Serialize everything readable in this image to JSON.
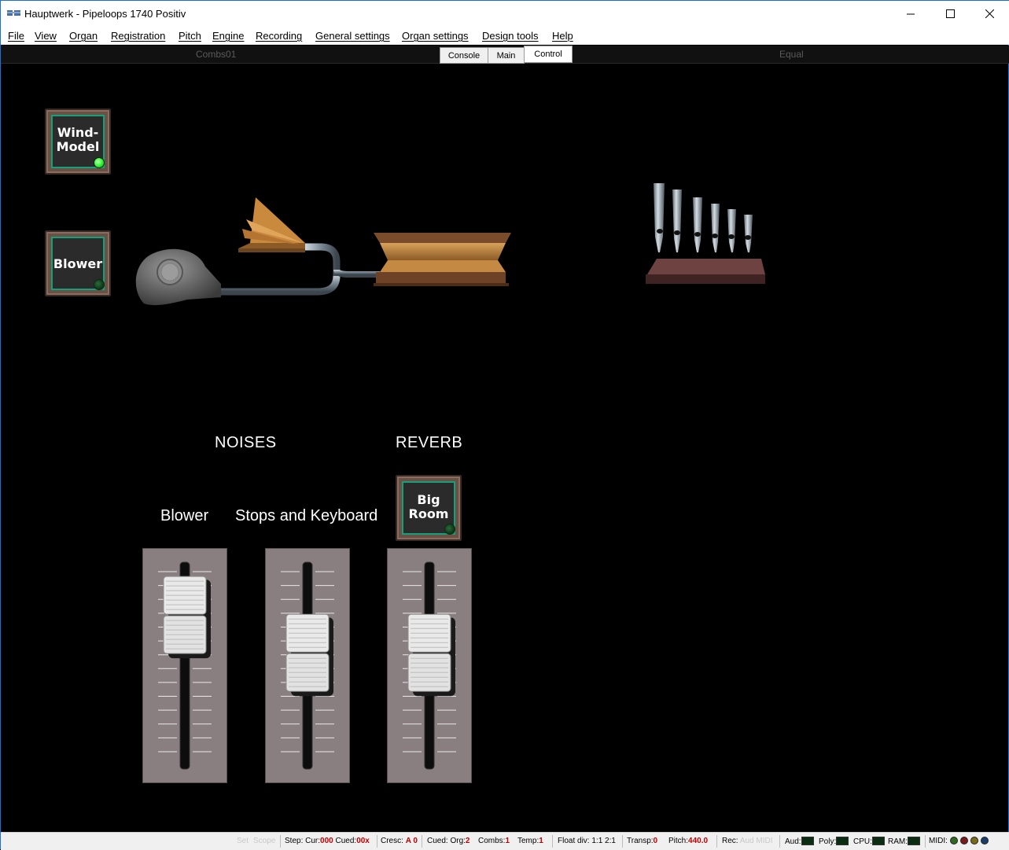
{
  "window": {
    "title": "Hauptwerk - Pipeloops 1740 Positiv"
  },
  "menu": [
    {
      "label": "File"
    },
    {
      "label": "View"
    },
    {
      "label": "Organ"
    },
    {
      "label": "Registration"
    },
    {
      "label": "Pitch"
    },
    {
      "label": "Engine"
    },
    {
      "label": "Recording"
    },
    {
      "label": "General settings"
    },
    {
      "label": "Organ settings"
    },
    {
      "label": "Design tools"
    },
    {
      "label": "Help"
    }
  ],
  "tabstrip": {
    "left_text": "Combs01",
    "right_text": "Equal",
    "tabs": [
      {
        "label": "Console"
      },
      {
        "label": "Main"
      },
      {
        "label": "Control"
      }
    ],
    "active_tab": "Control"
  },
  "buttons": {
    "wind_model": {
      "line1": "Wind-",
      "line2": "Model",
      "on": true
    },
    "blower": {
      "line1": "Blower",
      "on": false
    },
    "big_room": {
      "line1": "Big",
      "line2": "Room",
      "on": false
    }
  },
  "sections": {
    "noises": "NOISES",
    "reverb": "REVERB"
  },
  "faders": [
    {
      "label": "Blower",
      "level": 0.9
    },
    {
      "label": "Stops and Keyboard",
      "level": 0.75
    },
    {
      "label": "",
      "level": 0.75
    }
  ],
  "status": {
    "set": "Set",
    "scope": "Scope",
    "step_label": "Step: Cur:",
    "step_cur": "000",
    "cued_label": "Cued:",
    "step_cued": "00x",
    "cresc_label": "Cresc:",
    "cresc": "A 0",
    "cued_org_label": "Cued: Org:",
    "cued_org": "2",
    "combs_label": "Combs:",
    "combs": "1",
    "temp_label": "Temp:",
    "temp": "1",
    "float_label": "Float div:",
    "float": "1:1 2:1",
    "transp_label": "Transp:",
    "transp": "0",
    "pitch_label": "Pitch:",
    "pitch": "440.0",
    "rec_label": "Rec:",
    "aud_dim": "Aud",
    "midi_dim": "MIDI",
    "aud_label": "Aud:",
    "poly_label": "Poly:",
    "cpu_label": "CPU:",
    "ram_label": "RAM:",
    "midi_label": "MIDI:"
  },
  "colors": {
    "led_on": "#39ff3a",
    "led_off": "#0e3d1c",
    "button_frame": "#13a07a",
    "status_red": "#c00000"
  }
}
